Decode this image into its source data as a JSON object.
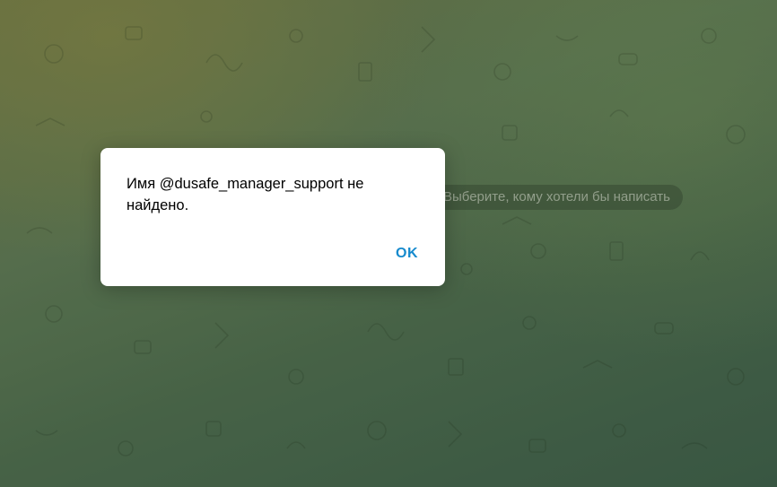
{
  "background": {
    "service_message": "Выберите, кому хотели бы написать"
  },
  "dialog": {
    "message": "Имя @dusafe_manager_support не найдено.",
    "ok_label": "OK"
  },
  "colors": {
    "accent": "#168acd",
    "dialog_bg": "#ffffff"
  }
}
